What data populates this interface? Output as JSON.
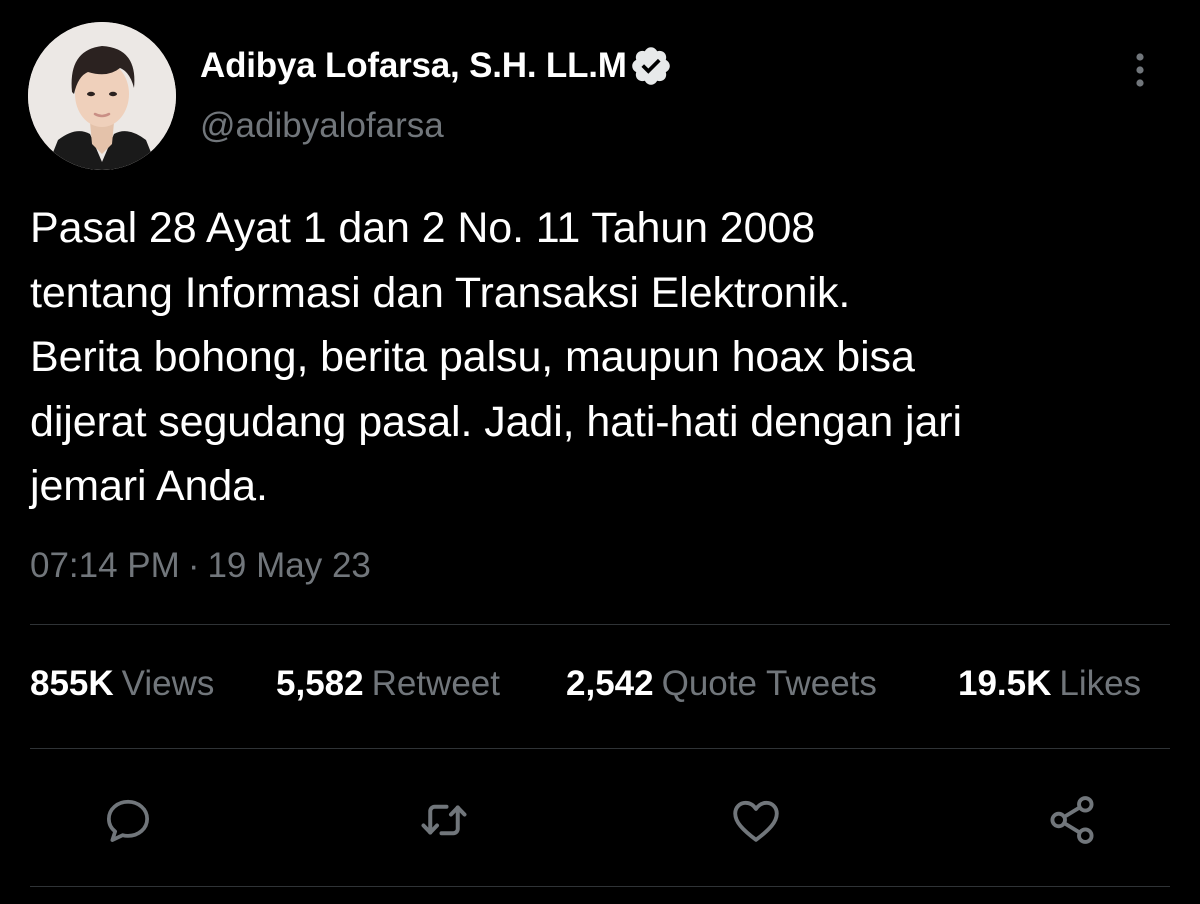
{
  "author": {
    "display_name": "Adibya Lofarsa, S.H. LL.M",
    "handle": "@adibyalofarsa",
    "verified": true
  },
  "tweet": {
    "text": "Pasal 28 Ayat 1 dan 2 No. 11 Tahun 2008\ntentang Informasi dan Transaksi Elektronik.\nBerita bohong, berita palsu, maupun hoax bisa\ndijerat segudang pasal. Jadi, hati-hati dengan jari\njemari Anda.",
    "time": "07:14 PM",
    "separator": "·",
    "date": "19 May 23"
  },
  "stats": {
    "views": {
      "value": "855K",
      "label": "Views"
    },
    "retweets": {
      "value": "5,582",
      "label": "Retweet"
    },
    "quotes": {
      "value": "2,542",
      "label": "Quote Tweets"
    },
    "likes": {
      "value": "19.5K",
      "label": "Likes"
    }
  },
  "icons": {
    "verified": "verified-badge-icon",
    "more": "more-vertical-icon",
    "reply": "reply-icon",
    "retweet": "retweet-icon",
    "like": "heart-icon",
    "share": "share-icon"
  },
  "colors": {
    "background": "#000000",
    "primary_text": "#ffffff",
    "secondary_text": "#71767b",
    "divider": "#2f3336"
  }
}
